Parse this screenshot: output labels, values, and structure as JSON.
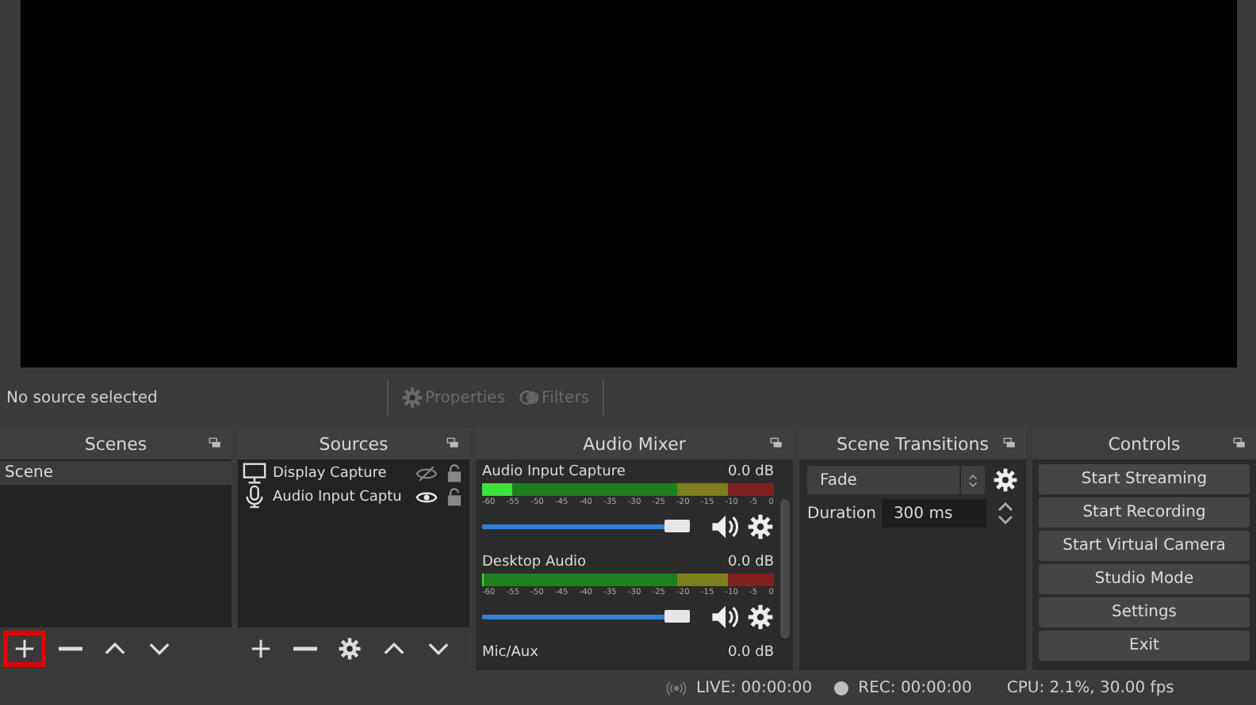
{
  "toolbar": {
    "source_label": "No source selected",
    "buttons": [
      {
        "kind": "properties",
        "label": "Properties",
        "disabled": true
      },
      {
        "kind": "filters",
        "label": "Filters",
        "disabled": true
      }
    ]
  },
  "scenes": {
    "title": "Scenes",
    "items": [
      {
        "name": "Scene",
        "selected": true
      }
    ],
    "buttons": [
      {
        "kind": "add",
        "highlighted": true
      },
      {
        "kind": "remove",
        "highlighted": false
      },
      {
        "kind": "up",
        "highlighted": false
      },
      {
        "kind": "down",
        "highlighted": false
      }
    ]
  },
  "sources": {
    "title": "Sources",
    "items": [
      {
        "name": "Display Capture",
        "kind": "display",
        "visible": false,
        "locked": false
      },
      {
        "name": "Audio Input Captu",
        "kind": "mic",
        "visible": true,
        "locked": false
      }
    ],
    "buttons": [
      {
        "kind": "add",
        "highlighted": false
      },
      {
        "kind": "remove",
        "highlighted": false
      },
      {
        "kind": "settings",
        "highlighted": false
      },
      {
        "kind": "up",
        "highlighted": false
      },
      {
        "kind": "down",
        "highlighted": false
      }
    ]
  },
  "audio_mixer": {
    "title": "Audio Mixer",
    "channels": [
      {
        "name": "Audio Input Capture",
        "reading": "0.0 dB",
        "meter": {
          "level": 0.1
        },
        "ticks": [
          "-60",
          "-55",
          "-50",
          "-45",
          "-40",
          "-35",
          "-30",
          "-25",
          "-20",
          "-15",
          "-10",
          "-5",
          "0"
        ],
        "fader": {
          "level": 0.88
        },
        "muted": false
      },
      {
        "name": "Desktop Audio",
        "reading": "0.0 dB",
        "meter": {
          "level": 0
        },
        "ticks": [
          "-60",
          "-55",
          "-50",
          "-45",
          "-40",
          "-35",
          "-30",
          "-25",
          "-20",
          "-15",
          "-10",
          "-5",
          "0"
        ],
        "fader": {
          "level": 0.88
        },
        "muted": false
      },
      {
        "name": "Mic/Aux",
        "reading": "0.0 dB"
      }
    ]
  },
  "scene_transitions": {
    "title": "Scene Transitions",
    "transition": "Fade",
    "duration_label": "Duration",
    "duration": "300 ms"
  },
  "controls": {
    "title": "Controls",
    "buttons": [
      "Start Streaming",
      "Start Recording",
      "Start Virtual Camera",
      "Studio Mode",
      "Settings",
      "Exit"
    ]
  },
  "status_bar": {
    "live": "LIVE: 00:00:00",
    "rec": "REC: 00:00:00",
    "cpu": "CPU: 2.1%, 30.00 fps"
  }
}
